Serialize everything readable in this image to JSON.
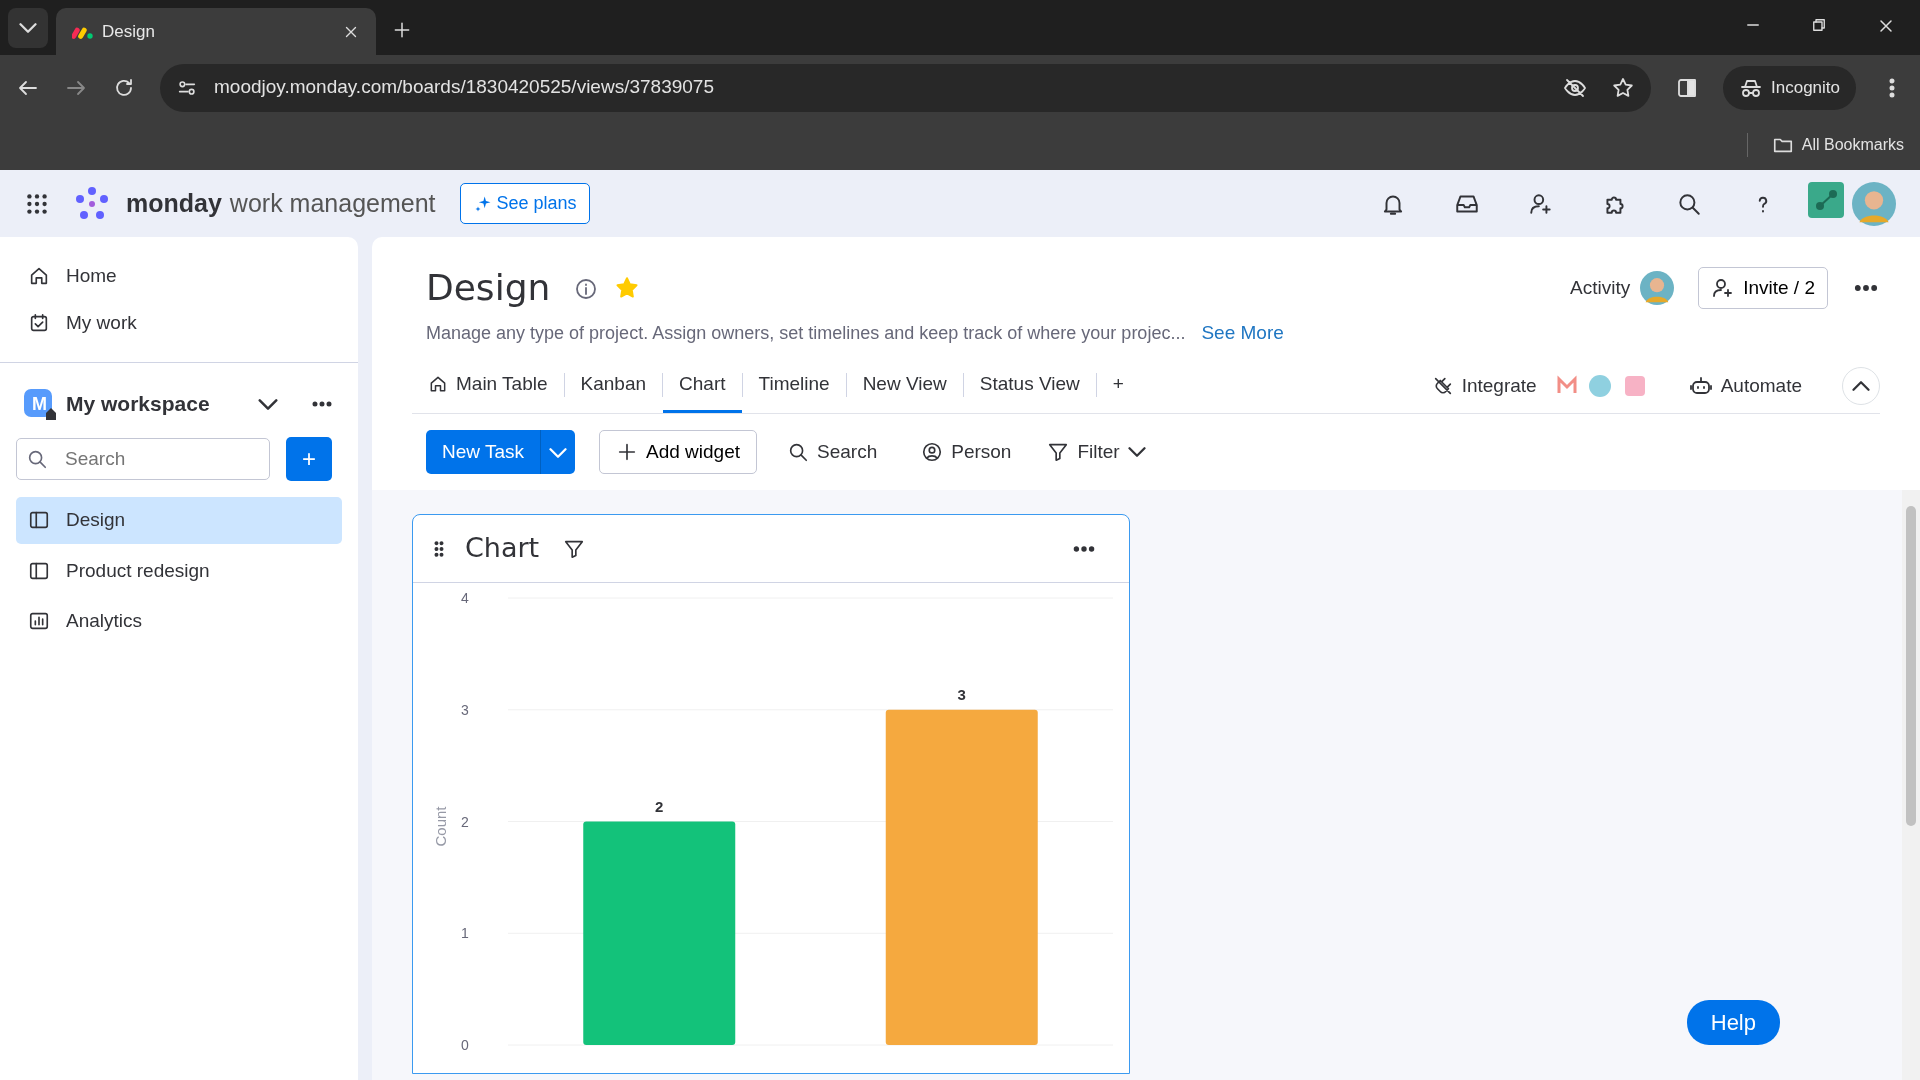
{
  "browser": {
    "tab_title": "Design",
    "url": "moodjoy.monday.com/boards/1830420525/views/37839075",
    "profile": "Incognito",
    "bookmarks": "All Bookmarks"
  },
  "app_header": {
    "brand": "monday",
    "product": "work management",
    "see_plans": "See plans"
  },
  "sidebar": {
    "nav": [
      {
        "label": "Home",
        "kind": "home"
      },
      {
        "label": "My work",
        "kind": "mywork"
      }
    ],
    "workspace": {
      "initial": "M",
      "name": "My workspace"
    },
    "search": {
      "placeholder": "Search"
    },
    "add_button": "+",
    "boards": [
      {
        "label": "Design",
        "kind": "board",
        "selected": true
      },
      {
        "label": "Product redesign",
        "kind": "board",
        "selected": false
      },
      {
        "label": "Analytics",
        "kind": "dashboard",
        "selected": false
      }
    ]
  },
  "board": {
    "title": "Design",
    "starred": true,
    "description": "Manage any type of project. Assign owners, set timelines and keep track of where your projec...",
    "see_more": "See More",
    "activity": "Activity",
    "invite": "Invite / 2",
    "views": [
      {
        "label": "Main Table",
        "kind": "home",
        "selected": false
      },
      {
        "label": "Kanban",
        "kind": "plain",
        "selected": false
      },
      {
        "label": "Chart",
        "kind": "plain",
        "selected": true
      },
      {
        "label": "Timeline",
        "kind": "plain",
        "selected": false
      },
      {
        "label": "New View",
        "kind": "plain",
        "selected": false
      },
      {
        "label": "Status View",
        "kind": "plain",
        "selected": false
      }
    ],
    "add_view": "+",
    "integrate": "Integrate",
    "automate": "Automate",
    "toolbar": {
      "new_task": "New Task",
      "add_widget": "Add widget",
      "search": "Search",
      "person": "Person",
      "filter": "Filter"
    }
  },
  "widget": {
    "title": "Chart",
    "chart_data": {
      "type": "bar",
      "ylabel": "Count",
      "ylim": [
        0,
        4
      ],
      "yticks": [
        0,
        1,
        2,
        3,
        4
      ],
      "data_labels": true,
      "grid": true,
      "series": [
        {
          "values": [
            2,
            3
          ]
        }
      ],
      "colors": [
        "#13c27a",
        "#f5a93f"
      ]
    }
  },
  "help": "Help"
}
